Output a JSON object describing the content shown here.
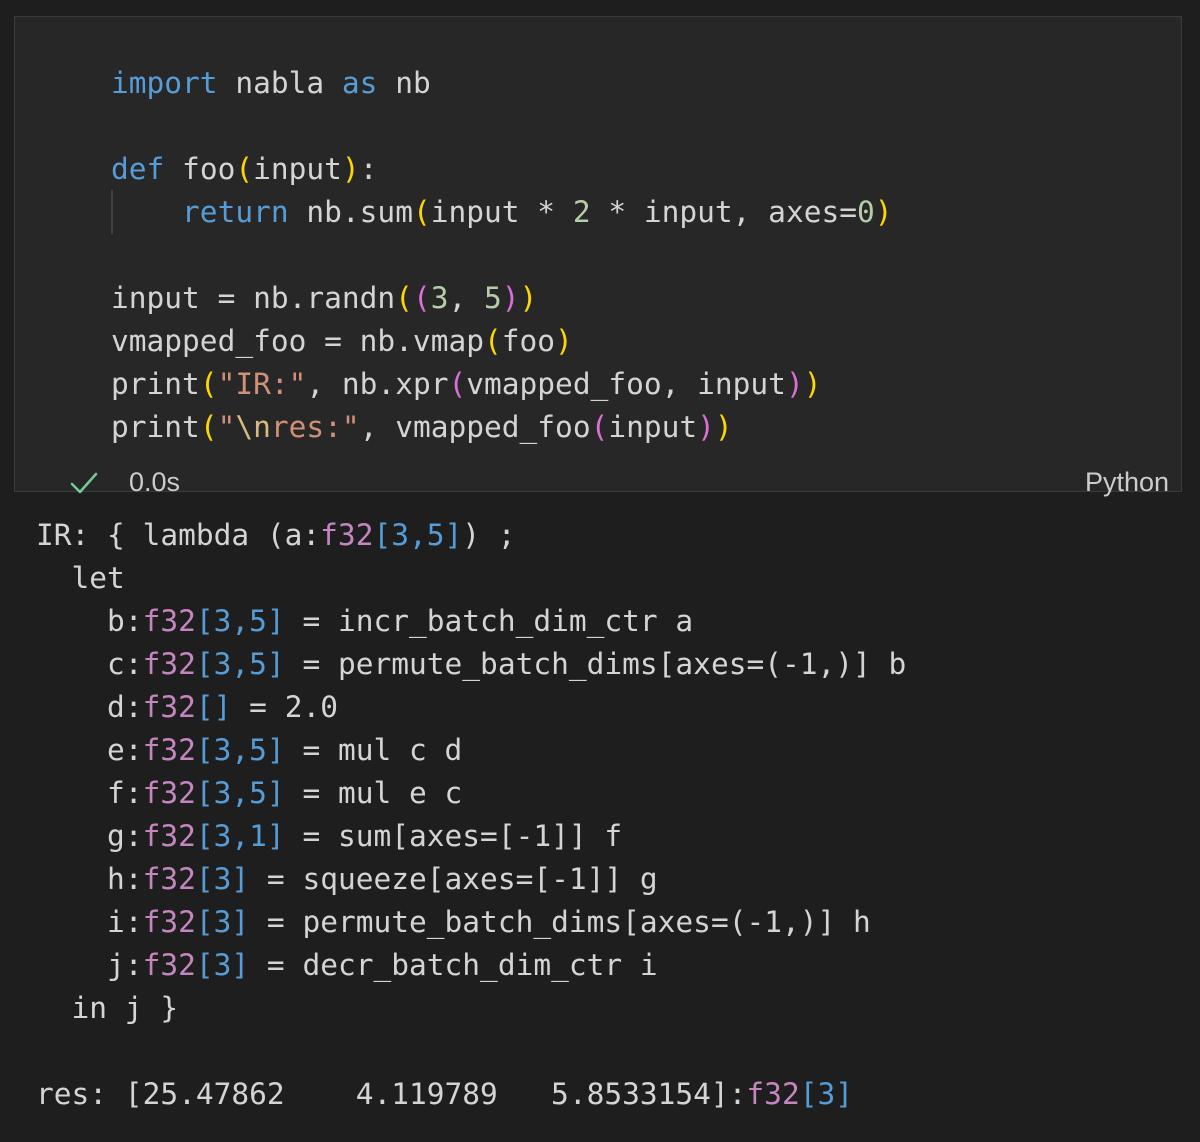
{
  "cell": {
    "code_lines": [
      {
        "segments": [
          {
            "t": "import",
            "c": "kw"
          },
          {
            "t": " nabla "
          },
          {
            "t": "as",
            "c": "kw"
          },
          {
            "t": " nb"
          }
        ]
      },
      {
        "segments": []
      },
      {
        "segments": [
          {
            "t": "def",
            "c": "kw"
          },
          {
            "t": " foo"
          },
          {
            "t": "(",
            "c": "p1"
          },
          {
            "t": "input"
          },
          {
            "t": ")",
            "c": "p1"
          },
          {
            "t": ":"
          }
        ]
      },
      {
        "segments": [
          {
            "t": "    "
          },
          {
            "t": "return",
            "c": "kw"
          },
          {
            "t": " nb.sum"
          },
          {
            "t": "(",
            "c": "p1"
          },
          {
            "t": "input * "
          },
          {
            "t": "2",
            "c": "num"
          },
          {
            "t": " * input, axes="
          },
          {
            "t": "0",
            "c": "num"
          },
          {
            "t": ")",
            "c": "p1"
          }
        ]
      },
      {
        "segments": []
      },
      {
        "segments": [
          {
            "t": "input = nb.randn"
          },
          {
            "t": "(",
            "c": "p1"
          },
          {
            "t": "(",
            "c": "p2"
          },
          {
            "t": "3",
            "c": "num"
          },
          {
            "t": ", "
          },
          {
            "t": "5",
            "c": "num"
          },
          {
            "t": ")",
            "c": "p2"
          },
          {
            "t": ")",
            "c": "p1"
          }
        ]
      },
      {
        "segments": [
          {
            "t": "vmapped_foo = nb.vmap"
          },
          {
            "t": "(",
            "c": "p1"
          },
          {
            "t": "foo"
          },
          {
            "t": ")",
            "c": "p1"
          }
        ]
      },
      {
        "segments": [
          {
            "t": "print"
          },
          {
            "t": "(",
            "c": "p1"
          },
          {
            "t": "\"IR:\"",
            "c": "str"
          },
          {
            "t": ", nb.xpr"
          },
          {
            "t": "(",
            "c": "p2"
          },
          {
            "t": "vmapped_foo, input"
          },
          {
            "t": ")",
            "c": "p2"
          },
          {
            "t": ")",
            "c": "p1"
          }
        ]
      },
      {
        "segments": [
          {
            "t": "print"
          },
          {
            "t": "(",
            "c": "p1"
          },
          {
            "t": "\"",
            "c": "str"
          },
          {
            "t": "\\n",
            "c": "esc"
          },
          {
            "t": "res:\"",
            "c": "str"
          },
          {
            "t": ", vmapped_foo"
          },
          {
            "t": "(",
            "c": "p2"
          },
          {
            "t": "input"
          },
          {
            "t": ")",
            "c": "p2"
          },
          {
            "t": ")",
            "c": "p1"
          }
        ]
      }
    ],
    "status": {
      "icon": "checkmark-icon",
      "icon_color": "#73c991",
      "duration": "0.0s",
      "language": "Python"
    }
  },
  "output": {
    "lines": [
      {
        "segments": [
          {
            "t": "IR: { lambda (a:"
          },
          {
            "t": "f32",
            "c": "dt"
          },
          {
            "t": "[3,5]",
            "c": "sh"
          },
          {
            "t": ") ;"
          }
        ]
      },
      {
        "segments": [
          {
            "t": "  let"
          }
        ]
      },
      {
        "segments": [
          {
            "t": "    b:"
          },
          {
            "t": "f32",
            "c": "dt"
          },
          {
            "t": "[3,5]",
            "c": "sh"
          },
          {
            "t": " = incr_batch_dim_ctr a"
          }
        ]
      },
      {
        "segments": [
          {
            "t": "    c:"
          },
          {
            "t": "f32",
            "c": "dt"
          },
          {
            "t": "[3,5]",
            "c": "sh"
          },
          {
            "t": " = permute_batch_dims[axes=(-1,)] b"
          }
        ]
      },
      {
        "segments": [
          {
            "t": "    d:"
          },
          {
            "t": "f32",
            "c": "dt"
          },
          {
            "t": "[]",
            "c": "sh"
          },
          {
            "t": " = 2.0"
          }
        ]
      },
      {
        "segments": [
          {
            "t": "    e:"
          },
          {
            "t": "f32",
            "c": "dt"
          },
          {
            "t": "[3,5]",
            "c": "sh"
          },
          {
            "t": " = mul c d"
          }
        ]
      },
      {
        "segments": [
          {
            "t": "    f:"
          },
          {
            "t": "f32",
            "c": "dt"
          },
          {
            "t": "[3,5]",
            "c": "sh"
          },
          {
            "t": " = mul e c"
          }
        ]
      },
      {
        "segments": [
          {
            "t": "    g:"
          },
          {
            "t": "f32",
            "c": "dt"
          },
          {
            "t": "[3,1]",
            "c": "sh"
          },
          {
            "t": " = sum[axes=[-1]] f"
          }
        ]
      },
      {
        "segments": [
          {
            "t": "    h:"
          },
          {
            "t": "f32",
            "c": "dt"
          },
          {
            "t": "[3]",
            "c": "sh"
          },
          {
            "t": " = squeeze[axes=[-1]] g"
          }
        ]
      },
      {
        "segments": [
          {
            "t": "    i:"
          },
          {
            "t": "f32",
            "c": "dt"
          },
          {
            "t": "[3]",
            "c": "sh"
          },
          {
            "t": " = permute_batch_dims[axes=(-1,)] h"
          }
        ]
      },
      {
        "segments": [
          {
            "t": "    j:"
          },
          {
            "t": "f32",
            "c": "dt"
          },
          {
            "t": "[3]",
            "c": "sh"
          },
          {
            "t": " = decr_batch_dim_ctr i"
          }
        ]
      },
      {
        "segments": [
          {
            "t": "  in j }"
          }
        ]
      }
    ],
    "result": {
      "segments": [
        {
          "t": "res: [25.47862    4.119789   5.8533154]:"
        },
        {
          "t": "f32",
          "c": "dt"
        },
        {
          "t": "[3]",
          "c": "sh"
        }
      ]
    }
  },
  "colors": {
    "background": "#1e1e1e",
    "cell_background": "#272727",
    "keyword": "#569cd6",
    "number": "#b5cea8",
    "string": "#ce9178",
    "escape": "#d7ba7d",
    "bracket_level1": "#ffd700",
    "bracket_level2": "#da70d6",
    "dtype": "#c586c0",
    "shape": "#569cd6"
  }
}
